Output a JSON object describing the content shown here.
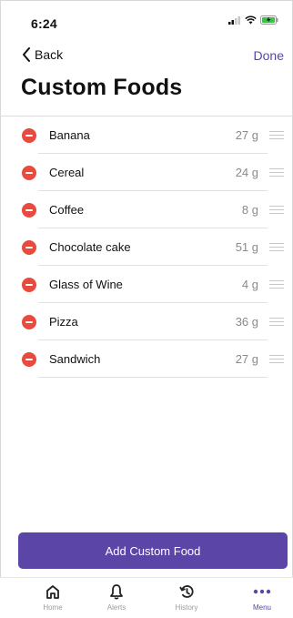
{
  "status_bar": {
    "time": "6:24"
  },
  "nav": {
    "back_label": "Back",
    "done_label": "Done"
  },
  "page": {
    "title": "Custom Foods"
  },
  "foods": [
    {
      "name": "Banana",
      "amount": "27 g"
    },
    {
      "name": "Cereal",
      "amount": "24 g"
    },
    {
      "name": "Coffee",
      "amount": "8 g"
    },
    {
      "name": "Chocolate cake",
      "amount": "51 g"
    },
    {
      "name": "Glass of Wine",
      "amount": "4 g"
    },
    {
      "name": "Pizza",
      "amount": "36 g"
    },
    {
      "name": "Sandwich",
      "amount": "27 g"
    }
  ],
  "actions": {
    "add_label": "Add Custom Food"
  },
  "tabbar": {
    "items": [
      {
        "label": "Home",
        "icon": "home-icon"
      },
      {
        "label": "Alerts",
        "icon": "bell-icon"
      },
      {
        "label": "History",
        "icon": "history-icon"
      },
      {
        "label": "Menu",
        "icon": "more-icon"
      }
    ],
    "active": "Menu"
  },
  "colors": {
    "accent": "#5b45a6",
    "delete": "#e84a3d",
    "muted": "#8a8a8a"
  }
}
